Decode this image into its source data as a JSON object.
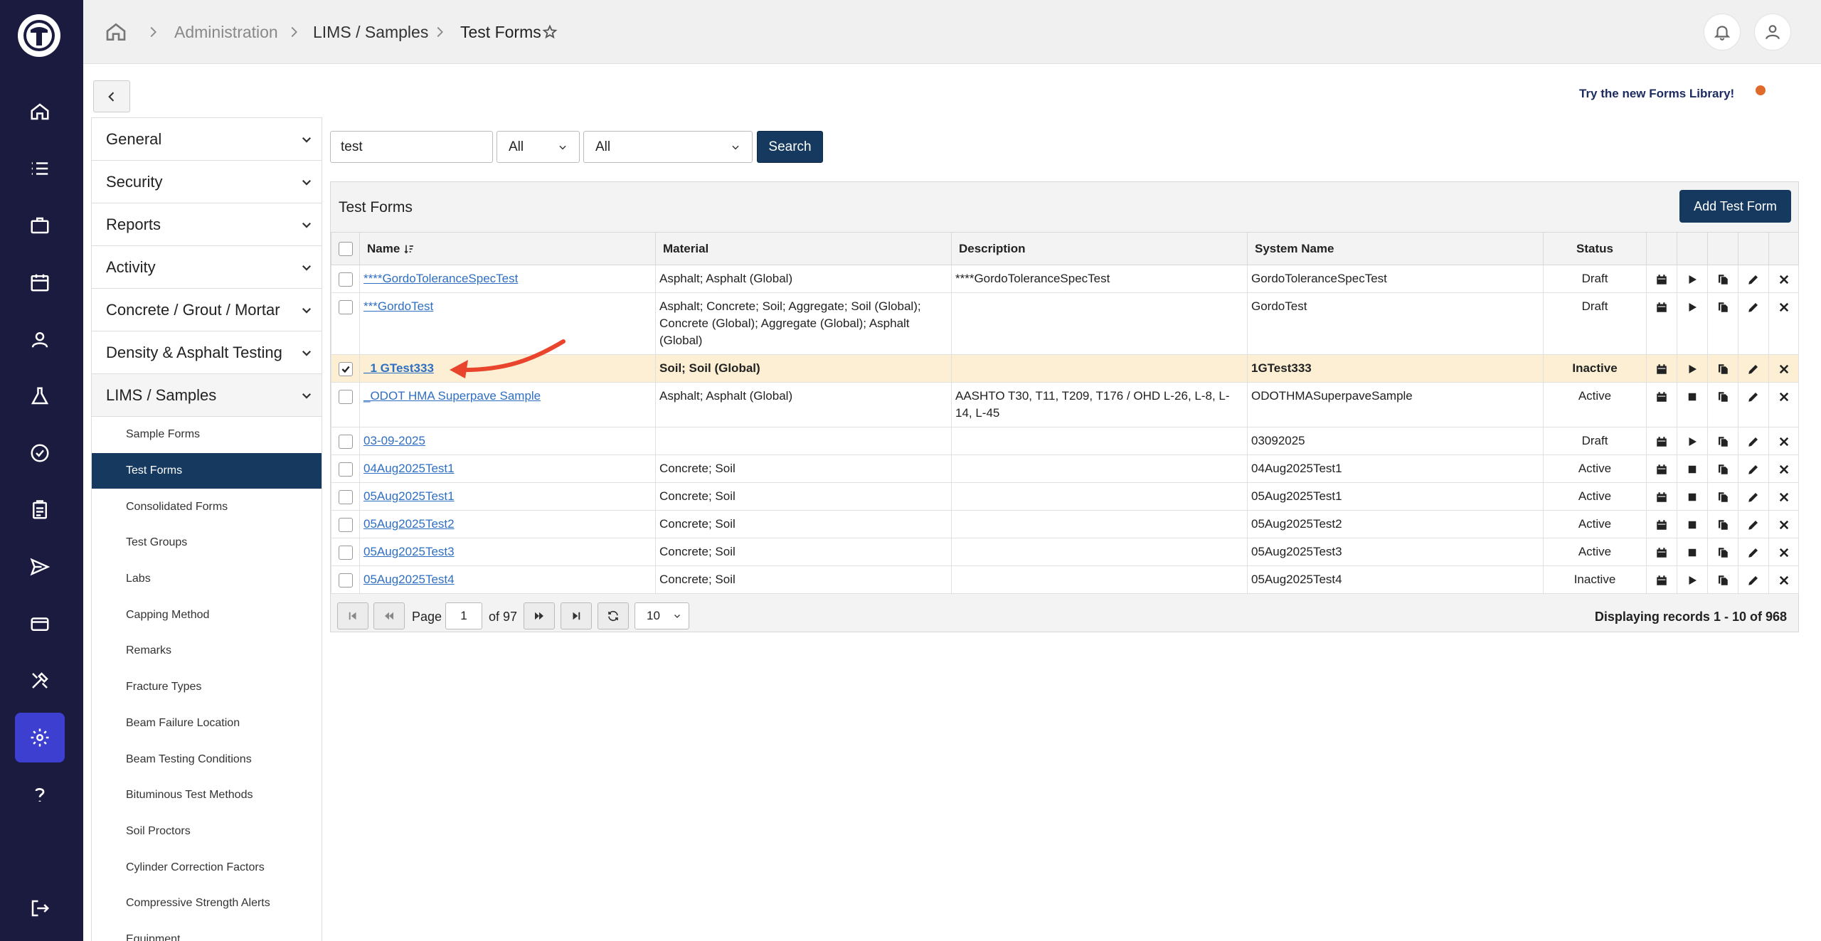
{
  "breadcrumb": {
    "admin": "Administration",
    "lims": "LIMS / Samples",
    "current": "Test Forms"
  },
  "rail_icons": [
    "logo-icon",
    "home-icon",
    "list-icon",
    "briefcase-icon",
    "calendar-icon",
    "user-badge-icon",
    "flask-icon",
    "badge-check-icon",
    "clipboard-icon",
    "send-icon",
    "card-icon",
    "tools-icon",
    "gear-icon",
    "help-icon",
    "logout-icon"
  ],
  "sidebar": {
    "sections": [
      "General",
      "Security",
      "Reports",
      "Activity",
      "Concrete / Grout / Mortar",
      "Density & Asphalt Testing",
      "LIMS / Samples"
    ],
    "items": [
      "Sample Forms",
      "Test Forms",
      "Consolidated Forms",
      "Test Groups",
      "Labs",
      "Capping Method",
      "Remarks",
      "Fracture Types",
      "Beam Failure Location",
      "Beam Testing Conditions",
      "Bituminous Test Methods",
      "Soil Proctors",
      "Cylinder Correction Factors",
      "Compressive Strength Alerts",
      "Equipment"
    ]
  },
  "try_link": "Try the new Forms Library!",
  "search": {
    "value": "test",
    "filter1": "All",
    "filter2": "All",
    "button": "Search"
  },
  "panel": {
    "title": "Test Forms",
    "add_button": "Add Test Form"
  },
  "table": {
    "headers": [
      "Name",
      "Material",
      "Description",
      "System Name",
      "Status"
    ],
    "rows": [
      {
        "name": "****GordoToleranceSpecTest",
        "material": "Asphalt; Asphalt (Global)",
        "description": "****GordoToleranceSpecTest",
        "system": "GordoToleranceSpecTest",
        "status": "Draft"
      },
      {
        "name": "***GordoTest",
        "material": "Asphalt; Concrete; Soil; Aggregate; Soil (Global); Concrete (Global); Aggregate (Global); Asphalt (Global)",
        "description": "",
        "system": "GordoTest",
        "status": "Draft"
      },
      {
        "name": "_1 GTest333",
        "material": "Soil; Soil (Global)",
        "description": "",
        "system": "1GTest333",
        "status": "Inactive"
      },
      {
        "name": "_ODOT HMA Superpave Sample",
        "material": "Asphalt; Asphalt (Global)",
        "description": "AASHTO T30, T11, T209, T176 / OHD L-26, L-8, L-14, L-45",
        "system": "ODOTHMASuperpaveSample",
        "status": "Active"
      },
      {
        "name": "03-09-2025",
        "material": "",
        "description": "",
        "system": "03092025",
        "status": "Draft"
      },
      {
        "name": "04Aug2025Test1",
        "material": "Concrete; Soil",
        "description": "",
        "system": "04Aug2025Test1",
        "status": "Active"
      },
      {
        "name": "05Aug2025Test1",
        "material": "Concrete; Soil",
        "description": "",
        "system": "05Aug2025Test1",
        "status": "Active"
      },
      {
        "name": "05Aug2025Test2",
        "material": "Concrete; Soil",
        "description": "",
        "system": "05Aug2025Test2",
        "status": "Active"
      },
      {
        "name": "05Aug2025Test3",
        "material": "Concrete; Soil",
        "description": "",
        "system": "05Aug2025Test3",
        "status": "Active"
      },
      {
        "name": "05Aug2025Test4",
        "material": "Concrete; Soil",
        "description": "",
        "system": "05Aug2025Test4",
        "status": "Inactive"
      }
    ]
  },
  "pager": {
    "page_label": "Page",
    "page": "1",
    "of_label": "of 97",
    "page_size": "10",
    "records": "Displaying records 1 - 10 of 968"
  },
  "colors": {
    "rail": "#1b1a3f",
    "accent": "#163a5f",
    "highlight": "#fcefd4",
    "annotation": "#e8452c"
  }
}
